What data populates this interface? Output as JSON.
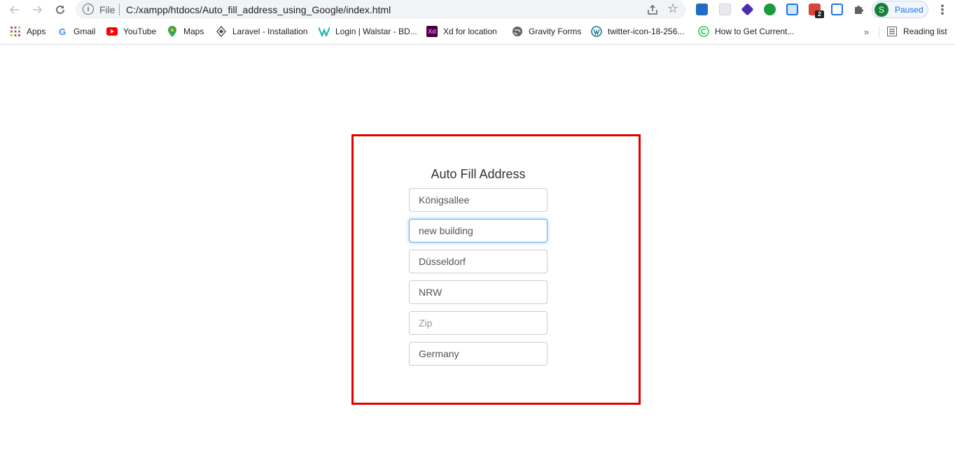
{
  "browser": {
    "omnibox": {
      "scheme_label": "File",
      "url": "C:/xampp/htdocs/Auto_fill_address_using_Google/index.html"
    },
    "profile": {
      "initial": "S",
      "status": "Paused"
    },
    "extension_badge": "2"
  },
  "bookmarks": [
    {
      "label": "Apps",
      "icon": "apps-grid-icon"
    },
    {
      "label": "Gmail",
      "icon": "google-icon"
    },
    {
      "label": "YouTube",
      "icon": "youtube-icon"
    },
    {
      "label": "Maps",
      "icon": "maps-pin-icon"
    },
    {
      "label": "Laravel - Installation",
      "icon": "laravel-icon"
    },
    {
      "label": "Login | Walstar - BD...",
      "icon": "walstar-icon"
    },
    {
      "label": "Xd for location",
      "icon": "xd-icon"
    },
    {
      "label": "Gravity Forms",
      "icon": "globe-icon"
    },
    {
      "label": "twitter-icon-18-256...",
      "icon": "wordpress-icon"
    },
    {
      "label": "How to Get Current...",
      "icon": "site-icon"
    }
  ],
  "reading_list": "Reading list",
  "form": {
    "title": "Auto Fill Address",
    "street": {
      "value": "Königsallee",
      "placeholder": ""
    },
    "building": {
      "value": "new building",
      "placeholder": ""
    },
    "city": {
      "value": "Düsseldorf",
      "placeholder": ""
    },
    "state": {
      "value": "NRW",
      "placeholder": ""
    },
    "zip": {
      "value": "",
      "placeholder": "Zip"
    },
    "country": {
      "value": "Germany",
      "placeholder": ""
    }
  },
  "colors": {
    "frame_border": "#e10000",
    "focus_ring": "#66afe9",
    "accent": "#1a73e8"
  }
}
